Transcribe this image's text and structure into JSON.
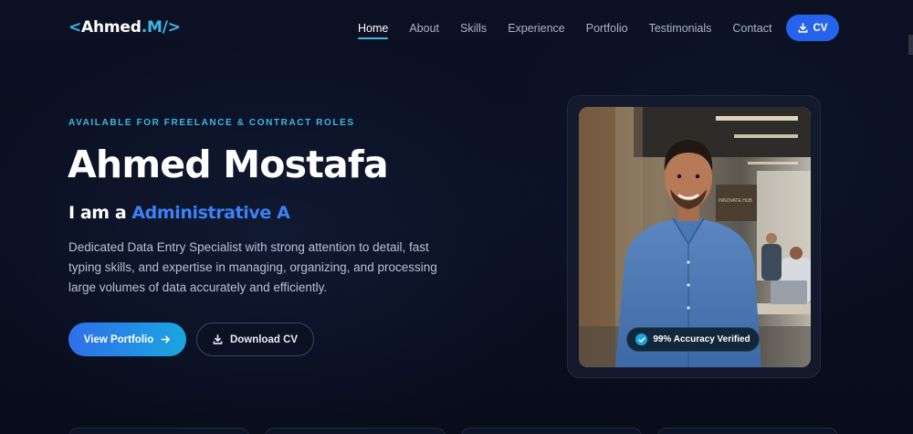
{
  "logo": {
    "open": "<",
    "name": "Ahmed",
    "mid": ".M",
    "close": "/>"
  },
  "nav": {
    "items": [
      {
        "label": "Home",
        "active": true
      },
      {
        "label": "About"
      },
      {
        "label": "Skills"
      },
      {
        "label": "Experience"
      },
      {
        "label": "Portfolio"
      },
      {
        "label": "Testimonials"
      },
      {
        "label": "Contact"
      }
    ],
    "cv_label": "CV",
    "cv_icon": "download-icon"
  },
  "hero": {
    "tagline": "AVAILABLE FOR FREELANCE & CONTRACT ROLES",
    "name": "Ahmed Mostafa",
    "role_prefix": "I am a",
    "role_typed": "Administrative A",
    "description": "Dedicated Data Entry Specialist with strong attention to detail, fast typing skills, and expertise in managing, organizing, and processing large volumes of data accurately and efficiently.",
    "primary_button": "View Portfolio",
    "primary_icon": "arrow-right-icon",
    "secondary_button": "Download CV",
    "secondary_icon": "download-icon"
  },
  "profile": {
    "badge": "99% Accuracy Verified",
    "badge_icon": "check-circle-icon",
    "photo_sign_text": "INNOVATE HUB"
  },
  "colors": {
    "background": "#0a0f1f",
    "accent": "#3fb6e8",
    "primary": "#2563eb",
    "role_text": "#3b82f6"
  }
}
